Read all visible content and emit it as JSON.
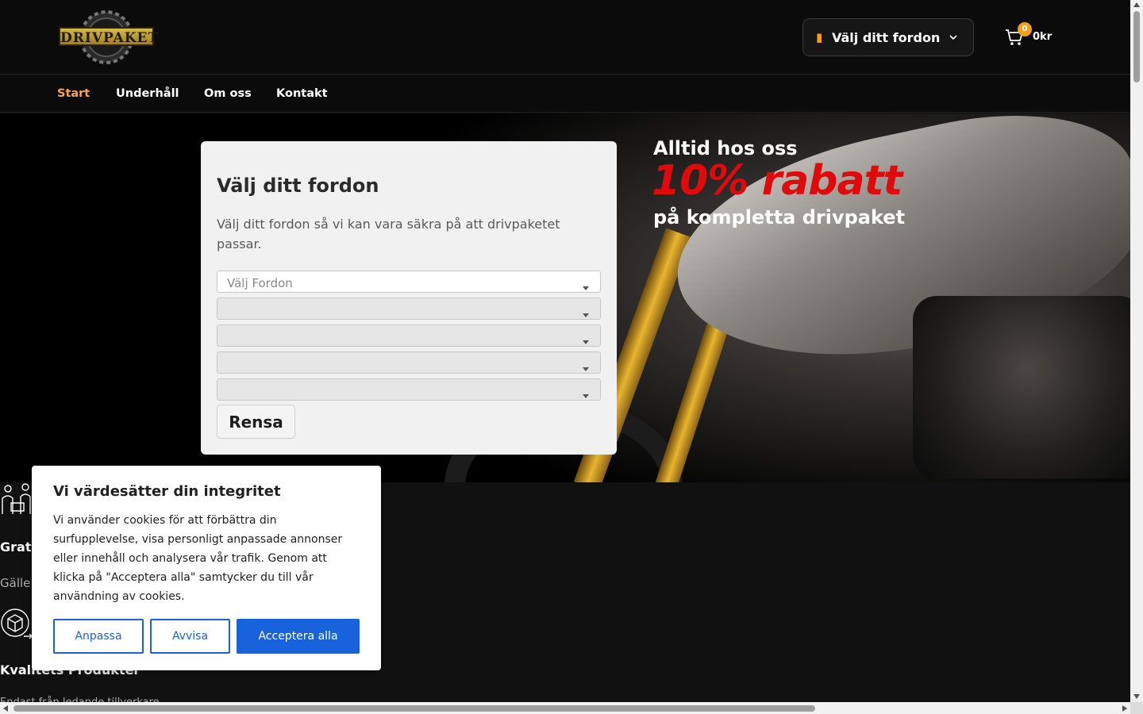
{
  "header": {
    "logo_text": "DRIVPAKET",
    "vehicle_button_label": "Välj ditt fordon",
    "cart_count": "0",
    "cart_total": "0kr"
  },
  "nav": {
    "items": [
      {
        "label": "Start",
        "active": true
      },
      {
        "label": "Underhåll"
      },
      {
        "label": "Om oss"
      },
      {
        "label": "Kontakt"
      }
    ]
  },
  "hero": {
    "promo_line1": "Alltid hos oss",
    "promo_line2": "10% rabatt",
    "promo_line3": "på kompletta drivpaket"
  },
  "selector": {
    "title": "Välj ditt fordon",
    "description": "Välj ditt fordon så vi kan vara säkra på att drivpaketet passar.",
    "first_placeholder": "Välj Fordon",
    "clear_label": "Rensa"
  },
  "features": {
    "item1_title": "Grat",
    "item1_sub": "Gälle",
    "item2_title": "Kvalitets Produkter",
    "item2_sub": "Endast från ledande tillverkare"
  },
  "cookie": {
    "title": "Vi värdesätter din integritet",
    "text": "Vi använder cookies för att förbättra din surfupplevelse, visa personligt anpassade annonser eller innehåll och analysera vår trafik. Genom att klicka på \"Acceptera alla\" samtycker du till vår användning av cookies.",
    "customize_label": "Anpassa",
    "reject_label": "Avvisa",
    "accept_label": "Acceptera alla"
  },
  "colors": {
    "accent": "#f0a01a",
    "promo_red": "#e10a0a",
    "cookie_blue": "#1863dc",
    "nav_active": "#f3a64a"
  }
}
